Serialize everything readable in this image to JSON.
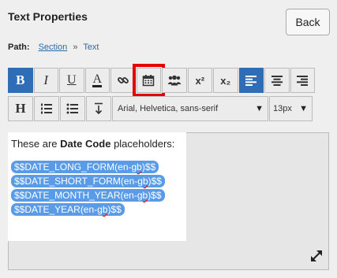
{
  "header": {
    "title": "Text Properties",
    "back_label": "Back"
  },
  "path": {
    "label": "Path:",
    "section": "Section",
    "separator": "»",
    "current": "Text"
  },
  "toolbar": {
    "row1": [
      {
        "name": "bold-button",
        "icon": "bold-icon",
        "glyph": "B",
        "active": true
      },
      {
        "name": "italic-button",
        "icon": "italic-icon",
        "glyph": "I"
      },
      {
        "name": "underline-button",
        "icon": "underline-icon",
        "glyph": "U"
      },
      {
        "name": "text-color-button",
        "icon": "text-color-icon",
        "glyph": "A"
      },
      {
        "name": "link-button",
        "icon": "link-icon"
      },
      {
        "name": "date-code-button",
        "icon": "calendar-icon",
        "highlighted": true
      },
      {
        "name": "users-button",
        "icon": "users-icon"
      },
      {
        "name": "superscript-button",
        "icon": "superscript-icon",
        "glyph": "x²"
      },
      {
        "name": "subscript-button",
        "icon": "subscript-icon",
        "glyph": "x₂"
      },
      {
        "name": "align-left-button",
        "icon": "align-left-icon",
        "active": true
      },
      {
        "name": "align-center-button",
        "icon": "align-center-icon"
      },
      {
        "name": "align-right-button",
        "icon": "align-right-icon"
      }
    ],
    "row2": [
      {
        "name": "heading-button",
        "icon": "heading-icon",
        "glyph": "H"
      },
      {
        "name": "ordered-list-button",
        "icon": "ordered-list-icon"
      },
      {
        "name": "bullet-list-button",
        "icon": "bullet-list-icon"
      },
      {
        "name": "line-height-button",
        "icon": "line-height-icon"
      }
    ],
    "font_family": "Arial, Helvetica, sans-serif",
    "font_size": "13px"
  },
  "editor": {
    "intro_before": "These are ",
    "intro_bold": "Date Code",
    "intro_after": " placeholders:",
    "placeholders": [
      {
        "pre": "$$DATE_LONG_FORM(en-",
        "sq": "gb",
        "post": ")$$"
      },
      {
        "pre": "$$DATE_SHORT_FORM(en-",
        "sq": "gb",
        "post": ")$$"
      },
      {
        "pre": "$$DATE_MONTH_YEAR(en-",
        "sq": "gb",
        "post": ")$$"
      },
      {
        "pre": "$$DATE_YEAR(en-",
        "sq": "gb",
        "post": ")$$"
      }
    ]
  },
  "colors": {
    "accent": "#2f6db7",
    "chip": "#5a9be8",
    "highlight": "#e60000"
  }
}
